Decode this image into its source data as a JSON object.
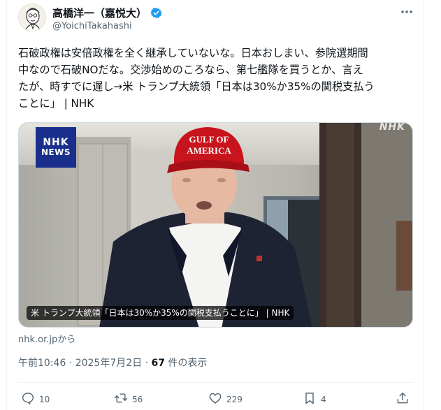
{
  "author": {
    "display_name": "高橋洋一（嘉悦大）",
    "handle": "@YoichiTakahashi"
  },
  "tweet": {
    "lines": [
      "石破政権は安倍政権を全く継承していないな。日本おしまい、参院選期間",
      "中なので石破NOだな。交渉始めのころなら、第七艦隊を買うとか、言え",
      "たが、時すでに遅し→米 トランプ大統領「日本は30%か35%の関税支払う",
      "ことに」 | NHK"
    ]
  },
  "media": {
    "badge_line1": "NHK",
    "badge_line2": "NEWS",
    "watermark": "NHK",
    "cap_text_line1": "GULF OF",
    "cap_text_line2": "AMERICA",
    "caption": "米 トランプ大統領「日本は30%か35%の関税支払うことに」 | NHK"
  },
  "source_label": "nhk.or.jpから",
  "meta": {
    "time": "午前10:46 · 2025年7月2日 · ",
    "views_count": "67",
    "views_label": " 件の表示"
  },
  "actions": {
    "replies": "10",
    "retweets": "56",
    "likes": "229",
    "bookmarks": "4"
  },
  "colors": {
    "verified": "#1d9bf0",
    "nhk_blue": "#1a2e8c",
    "text_secondary": "#536471"
  }
}
